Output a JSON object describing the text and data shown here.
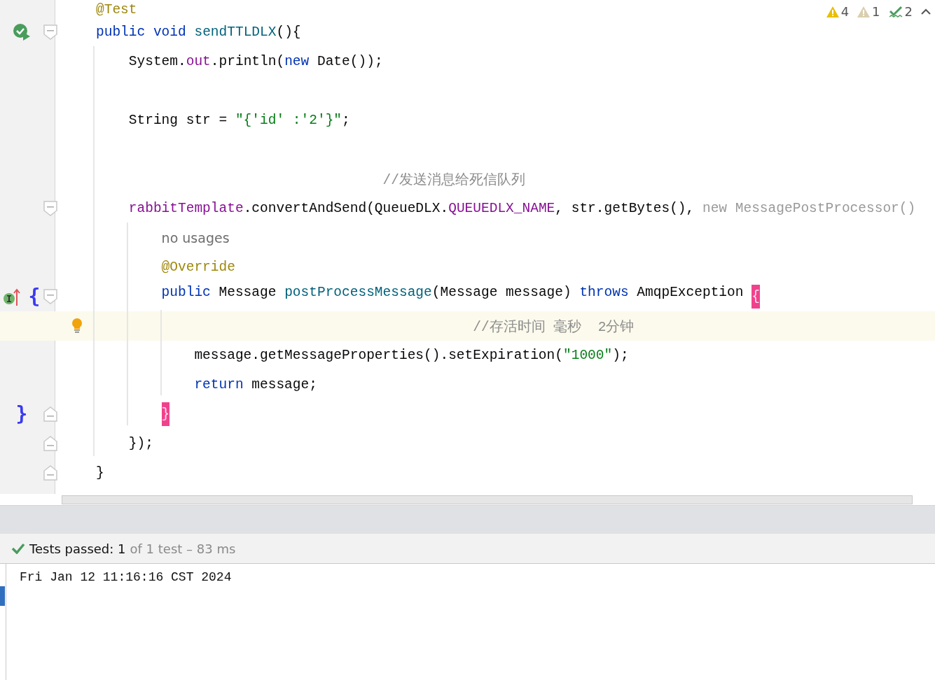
{
  "inspections": [
    {
      "kind": "warning",
      "count": "4"
    },
    {
      "kind": "weak-warning",
      "count": "1"
    },
    {
      "kind": "typo",
      "count": "2"
    }
  ],
  "lines": [
    {
      "kind": "code",
      "tokens": [
        {
          "kind": "annotation",
          "text": "@Test"
        }
      ]
    },
    {
      "kind": "code",
      "gutter": [
        {
          "kind": "run-passed"
        }
      ],
      "fold_start": true,
      "tokens": [
        {
          "kind": "keyword",
          "text": "public void "
        },
        {
          "kind": "decl",
          "text": "sendTTLDLX"
        },
        {
          "kind": "plain",
          "text": "(){"
        }
      ],
      "children": [
        {
          "kind": "code",
          "tokens": [
            {
              "kind": "plain",
              "text": "System."
            },
            {
              "kind": "field",
              "text": "out"
            },
            {
              "kind": "plain",
              "text": ".println("
            },
            {
              "kind": "keyword",
              "text": "new "
            },
            {
              "kind": "plain",
              "text": "Date());"
            }
          ]
        },
        {
          "kind": "blank"
        },
        {
          "kind": "code",
          "tokens": [
            {
              "kind": "plain",
              "text": "String str = "
            },
            {
              "kind": "string",
              "text": "\"{'id' :'2'}\""
            },
            {
              "kind": "plain",
              "text": ";"
            }
          ]
        },
        {
          "kind": "blank"
        },
        {
          "kind": "aligned-comment",
          "tokens": [
            {
              "kind": "comment",
              "text": "//发送消息给死信队列"
            }
          ]
        },
        {
          "kind": "code",
          "fold_start": true,
          "tokens": [
            {
              "kind": "field",
              "text": "rabbitTemplate"
            },
            {
              "kind": "plain",
              "text": ".convertAndSend(QueueDLX."
            },
            {
              "kind": "field",
              "text": "QUEUEDLX_NAME"
            },
            {
              "kind": "plain",
              "text": ", str.getBytes(), "
            },
            {
              "kind": "dim",
              "text": "new MessagePostProcessor()"
            }
          ],
          "children": [
            {
              "kind": "code",
              "tokens": [
                {
                  "kind": "hint",
                  "text": "no usages"
                }
              ]
            },
            {
              "kind": "code",
              "tokens": [
                {
                  "kind": "annotation",
                  "text": "@Override"
                }
              ]
            },
            {
              "kind": "code",
              "gutter": [
                {
                  "kind": "implements"
                },
                {
                  "kind": "brace",
                  "text": "{"
                }
              ],
              "fold_start": true,
              "tokens": [
                {
                  "kind": "keyword",
                  "text": "public "
                },
                {
                  "kind": "plain",
                  "text": "Message "
                },
                {
                  "kind": "decl",
                  "text": "postProcessMessage"
                },
                {
                  "kind": "plain",
                  "text": "(Message message) "
                },
                {
                  "kind": "keyword",
                  "text": "throws "
                },
                {
                  "kind": "plain",
                  "text": "AmqpException "
                },
                {
                  "kind": "match",
                  "text": "{"
                }
              ],
              "children": [
                {
                  "kind": "aligned-comment",
                  "current": true,
                  "intention": true,
                  "tokens": [
                    {
                      "kind": "comment",
                      "text": "//存活时间 毫秒  2分钟"
                    }
                  ]
                },
                {
                  "kind": "code",
                  "tokens": [
                    {
                      "kind": "plain",
                      "text": "message.getMessageProperties().setExpiration("
                    },
                    {
                      "kind": "string",
                      "text": "\"1000\""
                    },
                    {
                      "kind": "plain",
                      "text": ");"
                    }
                  ]
                },
                {
                  "kind": "code",
                  "tokens": [
                    {
                      "kind": "keyword",
                      "text": "return "
                    },
                    {
                      "kind": "plain",
                      "text": "message;"
                    }
                  ]
                }
              ]
            },
            {
              "kind": "code",
              "gutter": [
                {
                  "kind": "brace",
                  "text": "}"
                }
              ],
              "fold_end": true,
              "tokens": [
                {
                  "kind": "match",
                  "text": "}"
                }
              ]
            }
          ]
        },
        {
          "kind": "code",
          "fold_end": true,
          "tokens": [
            {
              "kind": "plain",
              "text": "});"
            }
          ]
        }
      ]
    },
    {
      "kind": "code",
      "fold_end": true,
      "tokens": [
        {
          "kind": "plain",
          "text": "}"
        }
      ]
    }
  ],
  "test_status": {
    "passed": true,
    "label": "Tests passed: 1",
    "detail": "of 1 test – 83 ms"
  },
  "console": [
    "Fri Jan 12 11:16:16 CST 2024"
  ]
}
